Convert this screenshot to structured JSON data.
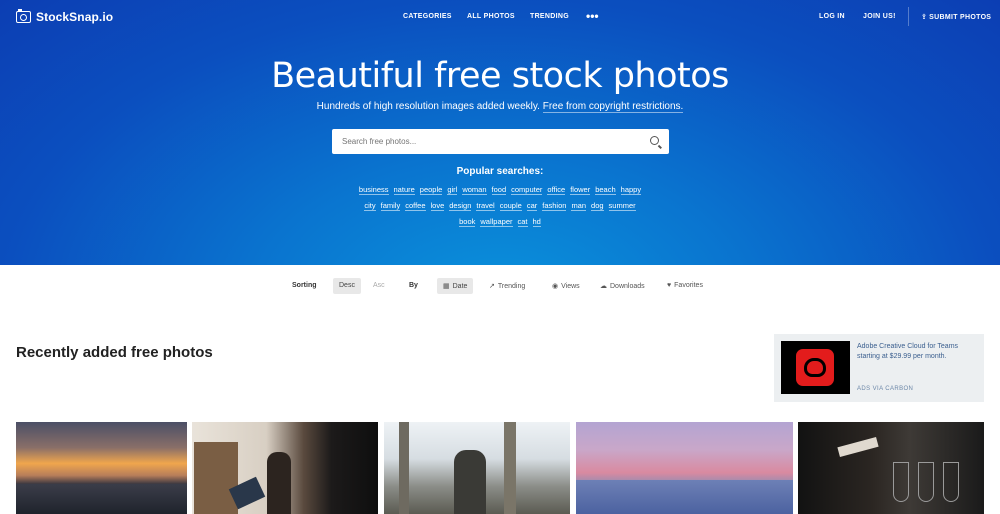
{
  "brand": {
    "name": "StockSnap.io"
  },
  "nav": {
    "categories": "CATEGORIES",
    "all_photos": "ALL PHOTOS",
    "trending": "TRENDING",
    "more": "•••",
    "login": "LOG IN",
    "join": "JOIN US!",
    "submit": "SUBMIT PHOTOS"
  },
  "hero": {
    "title": "Beautiful free stock photos",
    "subtitle": "Hundreds of high resolution images added weekly.",
    "subtitle_link": "Free from copyright restrictions."
  },
  "search": {
    "placeholder": "Search free photos..."
  },
  "popular": {
    "title": "Popular searches:",
    "row1": [
      "business",
      "nature",
      "people",
      "girl",
      "woman",
      "food",
      "computer",
      "office",
      "flower",
      "beach",
      "happy"
    ],
    "row2": [
      "city",
      "family",
      "coffee",
      "love",
      "design",
      "travel",
      "couple",
      "car",
      "fashion",
      "man",
      "dog",
      "summer"
    ],
    "row3": [
      "book",
      "wallpaper",
      "cat",
      "hd"
    ]
  },
  "sorting": {
    "label": "Sorting",
    "desc": "Desc",
    "asc": "Asc",
    "by_label": "By",
    "date": "Date",
    "trending": "Trending",
    "views": "Views",
    "downloads": "Downloads",
    "favorites": "Favorites"
  },
  "section": {
    "title": "Recently added free photos"
  },
  "ad": {
    "text": "Adobe Creative Cloud for Teams starting at $29.99 per month.",
    "via": "ADS VIA CARBON"
  },
  "icons": {
    "logo": "camera-icon",
    "upload": "upload-icon",
    "search": "search-icon",
    "calendar": "calendar-icon",
    "trending": "trend-line-icon",
    "views": "eye-icon",
    "downloads": "cloud-download-icon",
    "favorites": "heart-icon"
  },
  "colors": {
    "hero_top": "#0c3eb3",
    "hero_bottom": "#0a93dc",
    "ad_bg": "#eceff1",
    "ad_text": "#3b5f8f"
  }
}
